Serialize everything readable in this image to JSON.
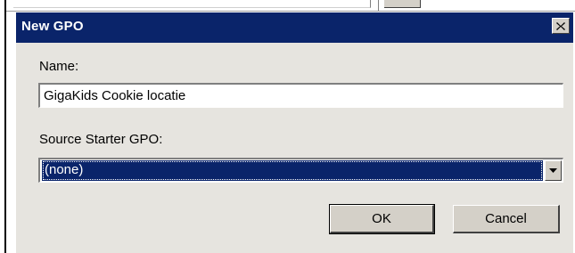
{
  "dialog": {
    "title": "New GPO",
    "name_label": "Name:",
    "name_value": "GigaKids Cookie locatie",
    "source_label": "Source Starter GPO:",
    "source_selected": "(none)",
    "ok_label": "OK",
    "cancel_label": "Cancel"
  },
  "icons": {
    "close": "close-icon",
    "dropdown": "chevron-down-icon"
  },
  "colors": {
    "titlebar": "#0a246a",
    "dialog_bg": "#e6e4df",
    "button_face": "#d4d0c8",
    "selection": "#0a246a"
  }
}
